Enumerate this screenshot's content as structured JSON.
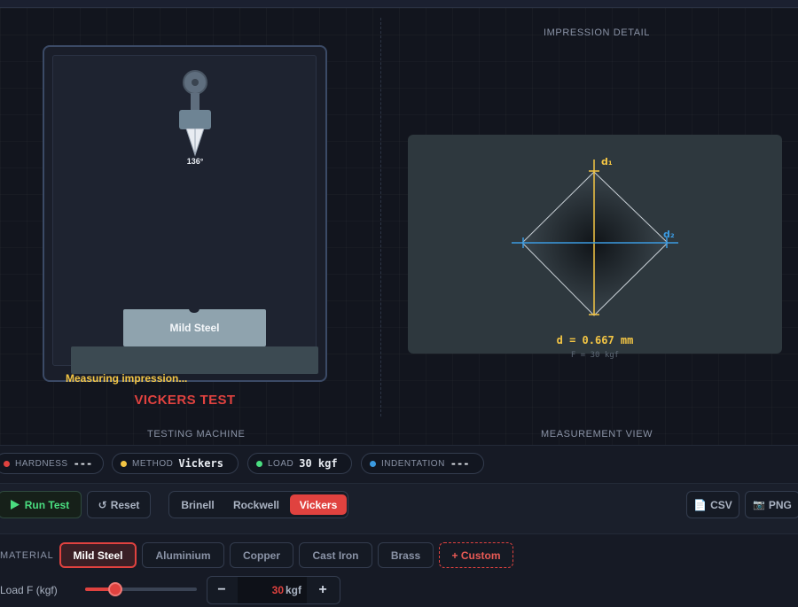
{
  "machine": {
    "section_label": "TESTING MACHINE",
    "angle_label": "136°",
    "specimen_label": "Mild Steel",
    "status": "Measuring impression...",
    "test_title": "VICKERS TEST"
  },
  "measurement": {
    "top_label": "IMPRESSION DETAIL",
    "section_label": "MEASUREMENT VIEW",
    "d1_label": "d₁",
    "d2_label": "d₂",
    "diagonal_readout": "d = 0.667 mm",
    "force_label": "F = 30 kgf"
  },
  "readouts": [
    {
      "label": "HARDNESS",
      "value": "---",
      "color": "#e0423f"
    },
    {
      "label": "METHOD",
      "value": "Vickers",
      "color": "#f3c544"
    },
    {
      "label": "LOAD",
      "value": "30 kgf",
      "color": "#4ade80"
    },
    {
      "label": "INDENTATION",
      "value": "---",
      "color": "#3b9ae0"
    }
  ],
  "toolbar": {
    "run_label": "Run Test",
    "run_icon": "play-icon",
    "reset_label": "Reset",
    "reset_icon": "reset-icon",
    "methods": [
      "Brinell",
      "Rockwell",
      "Vickers"
    ],
    "active_method": "Vickers",
    "csv_label": "CSV",
    "csv_icon": "file-icon",
    "png_label": "PNG",
    "png_icon": "camera-icon"
  },
  "material": {
    "label": "MATERIAL",
    "options": [
      "Mild Steel",
      "Aluminium",
      "Copper",
      "Cast Iron",
      "Brass"
    ],
    "active": "Mild Steel",
    "custom_label": "+ Custom"
  },
  "load": {
    "label": "Load F (kgf)",
    "value": "30",
    "unit": "kgf",
    "slider_fraction": 0.27,
    "minus": "−",
    "plus": "+"
  },
  "colors": {
    "accent_red": "#e0423f",
    "accent_yellow": "#f3c544",
    "accent_green": "#4ade80",
    "accent_blue": "#3b9ae0"
  }
}
